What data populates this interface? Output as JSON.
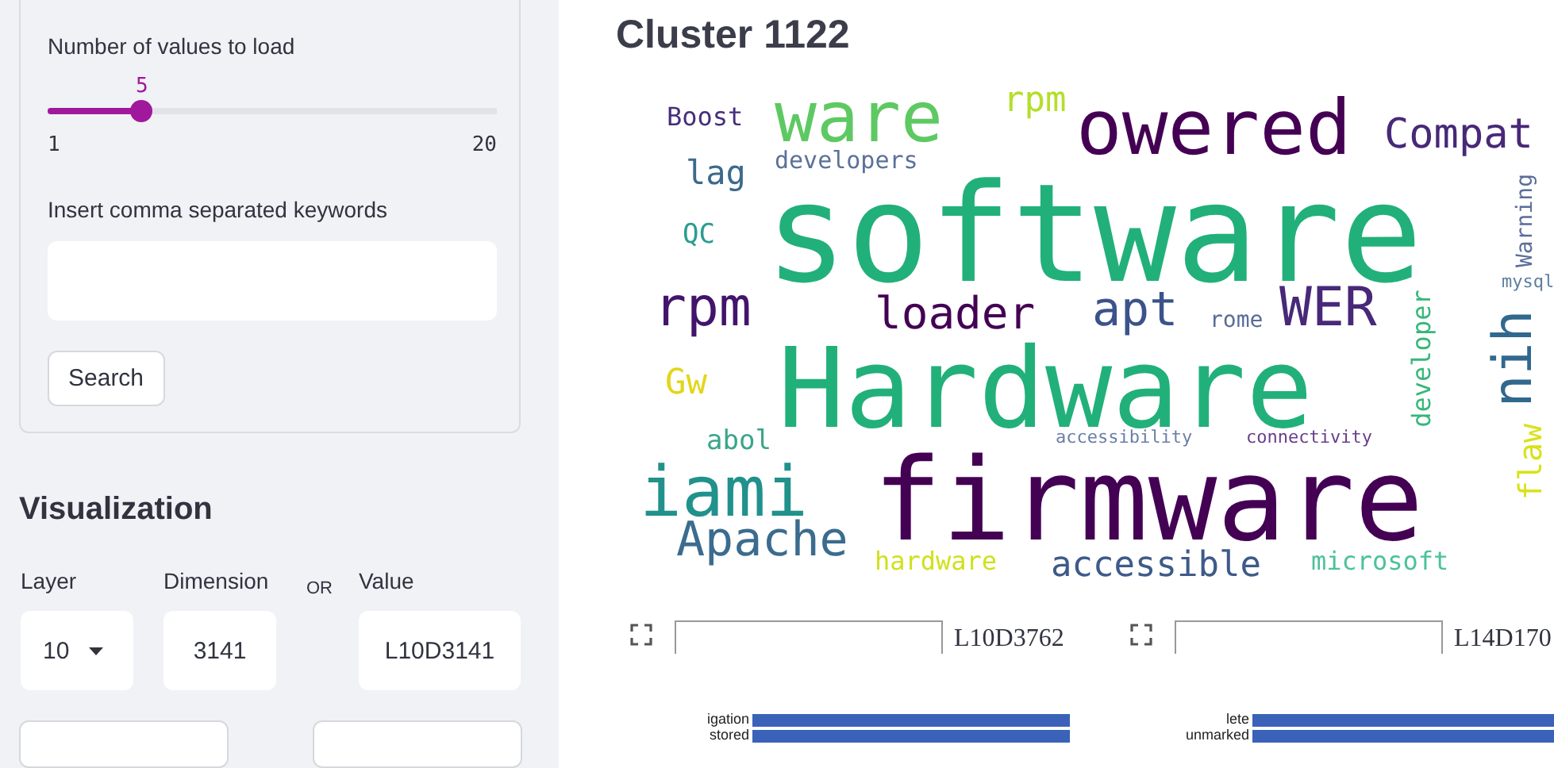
{
  "sidebar": {
    "slider": {
      "label": "Number of values to load",
      "value": "5",
      "min": "1",
      "max": "20",
      "level": 0.21
    },
    "keywords": {
      "label": "Insert comma separated keywords"
    },
    "search_button": "Search",
    "visualization": {
      "heading": "Visualization",
      "or_label": "OR",
      "fields": [
        {
          "label": "Layer",
          "value": "10",
          "kind": "select"
        },
        {
          "label": "Dimension",
          "value": "3141",
          "kind": "input"
        },
        {
          "label": "Value",
          "value": "L10D3141",
          "kind": "input"
        }
      ]
    }
  },
  "main": {
    "title": "Cluster 1122",
    "wordcloud": [
      {
        "text": "Boost",
        "color": "#472d7b"
      },
      {
        "text": "ware",
        "color": "#5ec962"
      },
      {
        "text": "rpm",
        "color": "#b5de2b"
      },
      {
        "text": "owered",
        "color": "#440154"
      },
      {
        "text": "Compat",
        "color": "#482878"
      },
      {
        "text": "lag",
        "color": "#3b6a8c"
      },
      {
        "text": "developers",
        "color": "#5b7199"
      },
      {
        "text": "QC",
        "color": "#2a9d8f"
      },
      {
        "text": "software",
        "color": "#22b07a"
      },
      {
        "text": "Warning",
        "color": "#5b6d99",
        "rotated": true
      },
      {
        "text": "rpm",
        "color": "#43146b"
      },
      {
        "text": "loader",
        "color": "#440154"
      },
      {
        "text": "apt",
        "color": "#3b528b"
      },
      {
        "text": "rome",
        "color": "#5b6d99"
      },
      {
        "text": "WER",
        "color": "#482878"
      },
      {
        "text": "Gw",
        "color": "#e2d61a"
      },
      {
        "text": "Hardware",
        "color": "#22b07a"
      },
      {
        "text": "developer",
        "color": "#35b779",
        "rotated": true
      },
      {
        "text": "mysql",
        "color": "#5b7ea0"
      },
      {
        "text": "nih",
        "color": "#31688e",
        "rotated": true
      },
      {
        "text": "abol",
        "color": "#3aa58b"
      },
      {
        "text": "accessibility",
        "color": "#6b7fa6"
      },
      {
        "text": "connectivity",
        "color": "#6a3d8a"
      },
      {
        "text": "iami",
        "color": "#21918c"
      },
      {
        "text": "Apache",
        "color": "#3b6c8f"
      },
      {
        "text": "firmware",
        "color": "#440154"
      },
      {
        "text": "flaw",
        "color": "#d8e219",
        "rotated": true
      },
      {
        "text": "hardware",
        "color": "#d0e11c"
      },
      {
        "text": "accessible",
        "color": "#3e5a8a"
      },
      {
        "text": "microsoft",
        "color": "#4cc29a"
      }
    ],
    "panels": [
      {
        "title": "L10D3762",
        "bar_labels": [
          "igation",
          "stored"
        ]
      },
      {
        "title": "L14D170",
        "bar_labels": [
          "lete",
          "unmarked"
        ]
      }
    ]
  }
}
